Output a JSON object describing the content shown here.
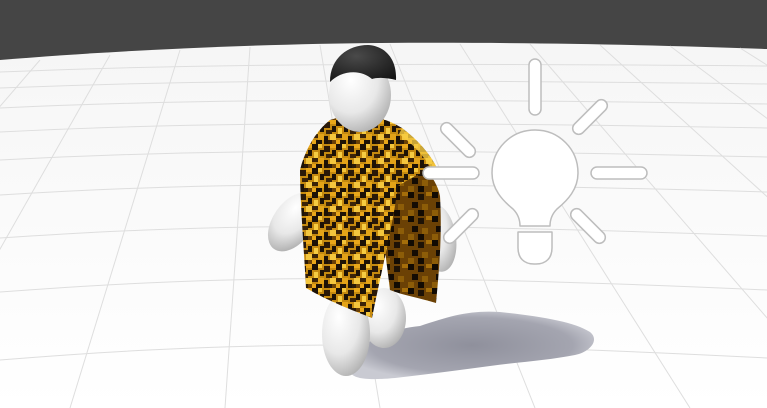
{
  "viewport": {
    "view": "unity-scene-view",
    "background_color": "#454545",
    "ground_color": "#fbfbfb",
    "grid_color": "#dedede"
  },
  "character": {
    "body_color": "#e9e9e9",
    "hair_color": "#2a2a2a",
    "cape_pattern": "leopard-print",
    "cape_colors": [
      "#1d1206",
      "#6b4105",
      "#b97a0c",
      "#e9a71a",
      "#f6cc42"
    ]
  },
  "light_gizmo": {
    "icon": "light-bulb-icon",
    "color": "#ffffff",
    "outline_color": "#bdbdbd"
  },
  "shadow": {
    "color": "#9a9ba6"
  }
}
